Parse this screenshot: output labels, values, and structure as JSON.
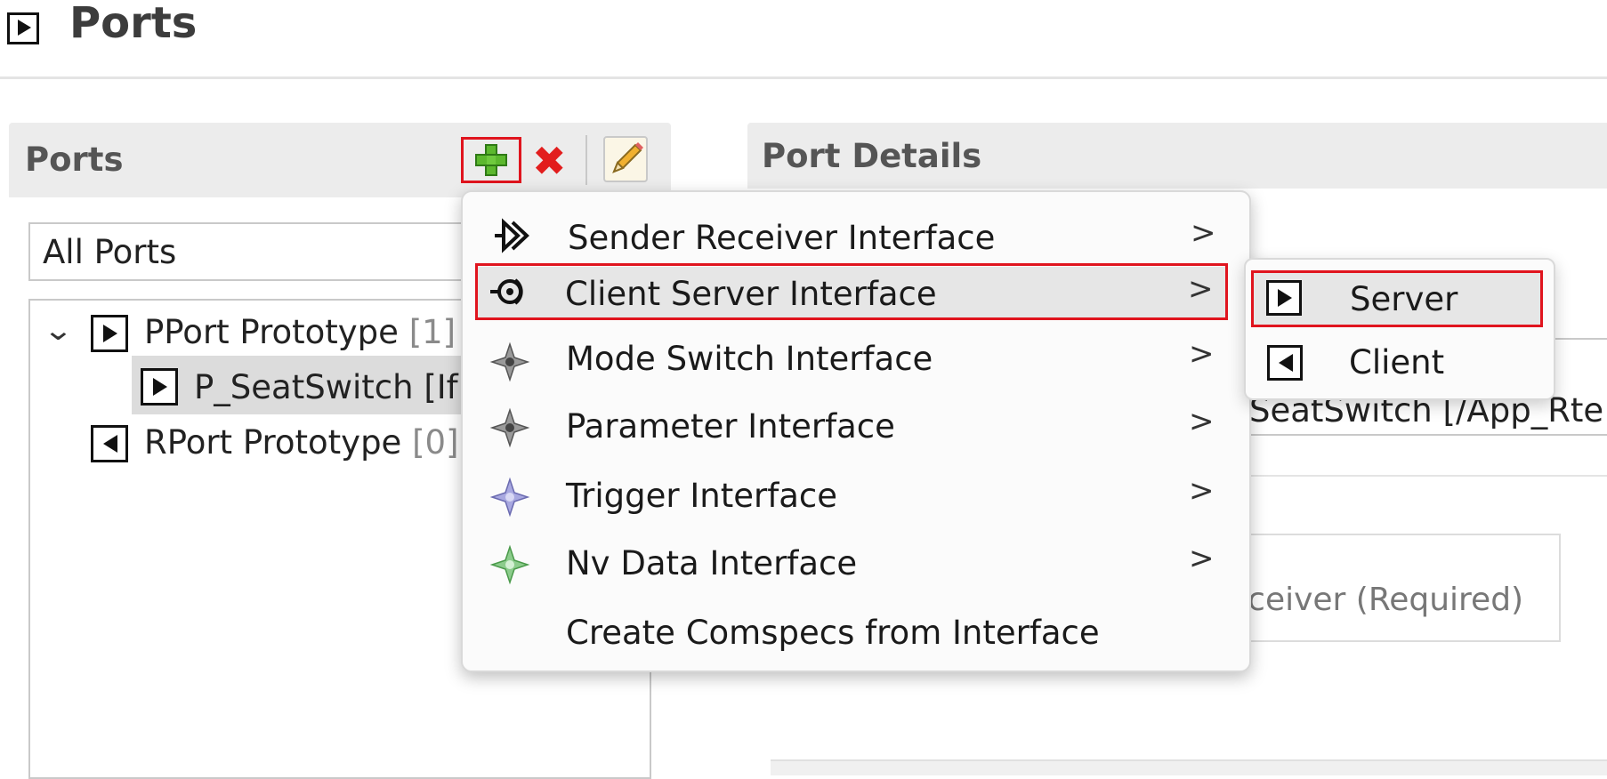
{
  "header": {
    "title": "Ports",
    "icon": "port-provided-icon"
  },
  "ports_panel": {
    "title": "Ports",
    "toolbar": {
      "add_icon": "plus-icon",
      "delete_icon": "delete-x-icon",
      "edit_icon": "pencil-icon"
    },
    "filter": {
      "value": "All Ports"
    },
    "tree": {
      "pport": {
        "label": "PPort Prototype",
        "count": "[1]"
      },
      "pport_child": {
        "label": "P_SeatSwitch [If"
      },
      "rport": {
        "label": "RPort Prototype",
        "count": "[0]"
      }
    }
  },
  "details_panel": {
    "title": "Port Details",
    "interface_value": "SeatSwitch [/App_Rte",
    "role_text": "eceiver (Required)"
  },
  "context_menu": {
    "items": [
      {
        "label": "Sender Receiver Interface",
        "icon": "sender-receiver-icon",
        "submenu": true
      },
      {
        "label": "Client Server Interface",
        "icon": "client-server-icon",
        "submenu": true
      },
      {
        "label": "Mode Switch Interface",
        "icon": "mode-switch-icon",
        "submenu": true
      },
      {
        "label": "Parameter Interface",
        "icon": "parameter-icon",
        "submenu": true
      },
      {
        "label": "Trigger Interface",
        "icon": "trigger-icon",
        "submenu": true
      },
      {
        "label": "Nv Data Interface",
        "icon": "nv-data-icon",
        "submenu": true
      },
      {
        "label": "Create Comspecs from Interface",
        "icon": "",
        "submenu": false
      }
    ],
    "chevron": ">"
  },
  "submenu": {
    "items": [
      {
        "label": "Server",
        "icon": "server-port-icon"
      },
      {
        "label": "Client",
        "icon": "client-port-icon"
      }
    ]
  },
  "colors": {
    "highlight_red": "#e0141e",
    "add_green": "#5cb82e",
    "delete_red": "#e21d1d"
  }
}
